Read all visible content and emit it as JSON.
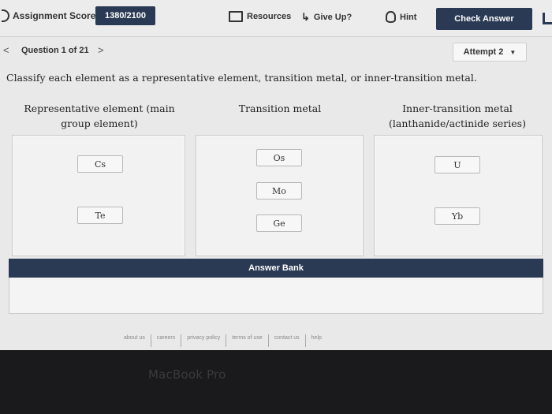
{
  "toolbar": {
    "score_label": "Assignment Score:",
    "score_value": "1380/2100",
    "resources": "Resources",
    "give_up": "Give Up?",
    "hint": "Hint",
    "check_answer": "Check Answer"
  },
  "question_nav": {
    "prev_icon": "<",
    "label": "Question 1 of 21",
    "next_icon": ">",
    "attempt": "Attempt 2"
  },
  "prompt": "Classify each element as a representative element, transition metal, or inner-transition metal.",
  "categories": [
    {
      "title_line1": "Representative element (main",
      "title_line2": "group element)",
      "items": [
        "Cs",
        "Te"
      ]
    },
    {
      "title_line1": "Transition metal",
      "title_line2": "",
      "items": [
        "Os",
        "Mo",
        "Ge"
      ]
    },
    {
      "title_line1": "Inner-transition metal",
      "title_line2": "(lanthanide/actinide series)",
      "items": [
        "U",
        "Yb"
      ]
    }
  ],
  "answer_bank": {
    "label": "Answer Bank"
  },
  "footer": {
    "links": [
      "about us",
      "careers",
      "privacy policy",
      "terms of use",
      "contact us",
      "help"
    ]
  },
  "device_label": "MacBook Pro"
}
